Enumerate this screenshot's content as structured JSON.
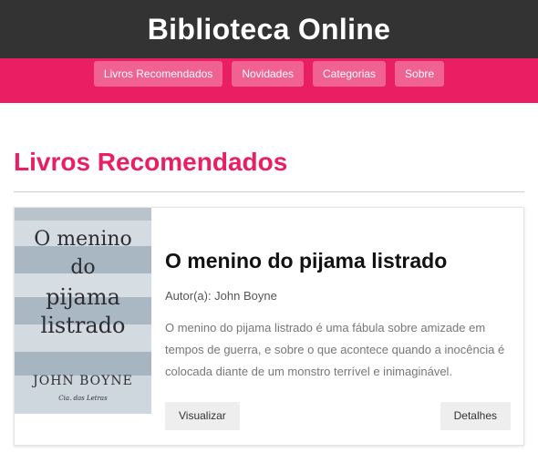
{
  "header": {
    "title": "Biblioteca Online"
  },
  "nav": {
    "items": [
      "Livros Recomendados",
      "Novidades",
      "Categorias",
      "Sobre"
    ]
  },
  "main": {
    "section_title": "Livros Recomendados",
    "book": {
      "title": "O menino do pijama listrado",
      "author": "Autor(a): John Boyne",
      "description": "O menino do pijama listrado é uma fábula sobre amizade em tempos de guerra, e sobre o que acontece quando a inocência é colocada diante de um monstro terrível e inimaginável.",
      "cover": {
        "lines": [
          "O menino",
          "do",
          "pijama",
          "listrado"
        ],
        "author": "JOHN BOYNE",
        "publisher": "Cia. das Letras"
      },
      "view_label": "Visualizar",
      "details_label": "Detalhes"
    }
  },
  "colors": {
    "header_bg": "#333333",
    "accent": "#e91e63",
    "nav_button": "#f06292"
  }
}
